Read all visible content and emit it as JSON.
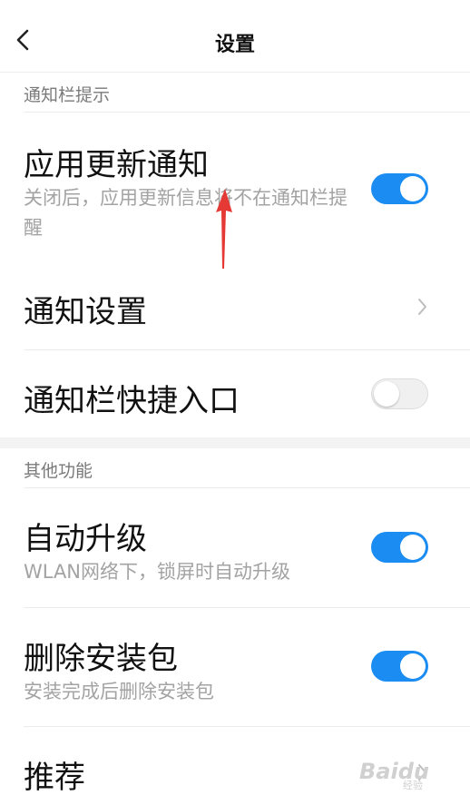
{
  "header": {
    "title": "设置"
  },
  "sections": {
    "notify": {
      "label": "通知栏提示"
    },
    "other": {
      "label": "其他功能"
    }
  },
  "items": {
    "app_update": {
      "title": "应用更新通知",
      "subtitle": "关闭后，应用更新信息将不在通知栏提醒",
      "enabled": true
    },
    "notify_settings": {
      "title": "通知设置"
    },
    "quick_entry": {
      "title": "通知栏快捷入口",
      "enabled": false
    },
    "auto_upgrade": {
      "title": "自动升级",
      "subtitle": "WLAN网络下，锁屏时自动升级",
      "enabled": true
    },
    "delete_pkg": {
      "title": "删除安装包",
      "subtitle": "安装完成后删除安装包",
      "enabled": true
    },
    "recommend": {
      "title": "推荐"
    }
  },
  "watermark": {
    "brand": "Baidu",
    "sub": "经验"
  },
  "colors": {
    "toggle_on": "#1a8cf2",
    "annotation_arrow": "#e53935"
  }
}
